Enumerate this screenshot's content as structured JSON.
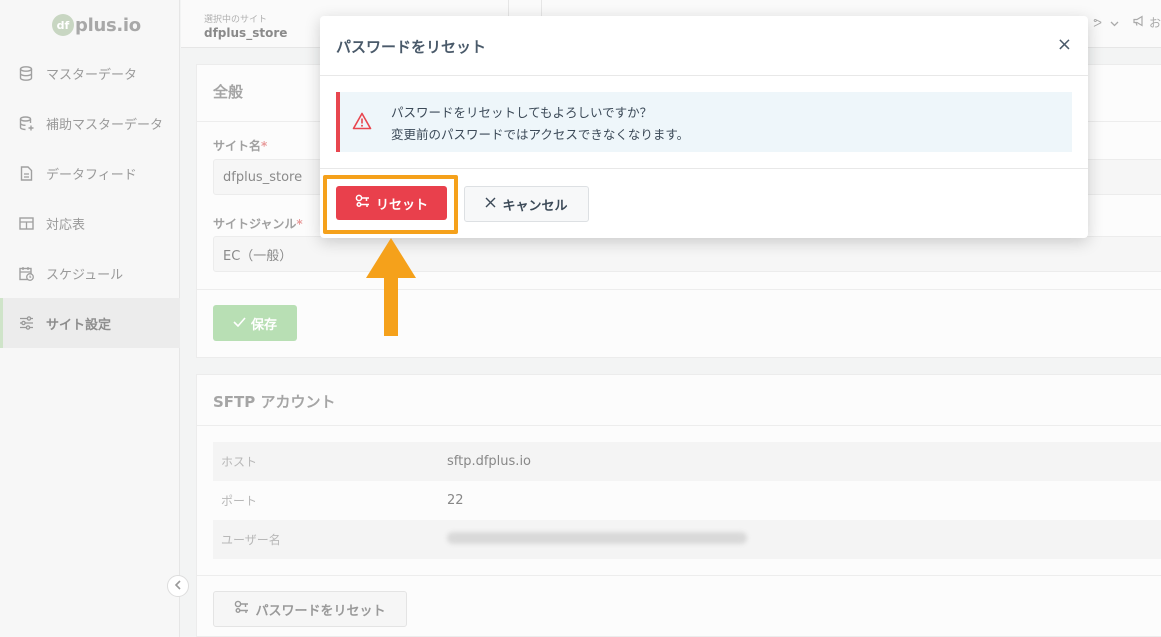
{
  "app": {
    "logo_mark": "df",
    "logo_text": "plus.io"
  },
  "sidebar": {
    "items": [
      {
        "label": "マスターデータ",
        "icon": "database-icon"
      },
      {
        "label": "補助マスターデータ",
        "icon": "database-plus-icon"
      },
      {
        "label": "データフィード",
        "icon": "document-icon"
      },
      {
        "label": "対応表",
        "icon": "table-icon"
      },
      {
        "label": "スケジュール",
        "icon": "calendar-clock-icon"
      },
      {
        "label": "サイト設定",
        "icon": "sliders-icon",
        "active": true
      }
    ]
  },
  "header": {
    "site_label": "選択中のサイト",
    "site_value": "dfplus_store",
    "right_text_1": "ᕗ",
    "right_text_2": "お"
  },
  "general": {
    "title": "全般",
    "site_name_label": "サイト名",
    "site_name_value": "dfplus_store",
    "site_genre_label": "サイトジャンル",
    "site_genre_value": "EC（一般）",
    "save_label": "保存",
    "required_mark": "*"
  },
  "sftp": {
    "title": "SFTP アカウント",
    "rows": [
      {
        "key": "ホスト",
        "value": "sftp.dfplus.io"
      },
      {
        "key": "ポート",
        "value": "22"
      },
      {
        "key": "ユーザー名",
        "value": ""
      }
    ],
    "reset_button_label": "パスワードをリセット"
  },
  "modal": {
    "title": "パスワードをリセット",
    "alert_line1": "パスワードをリセットしてもよろしいですか？",
    "alert_line2": "変更前のパスワードではアクセスできなくなります。",
    "confirm_label": "リセット",
    "cancel_label": "キャンセル",
    "close_glyph": "×"
  },
  "colors": {
    "danger": "#e9404c",
    "highlight": "#f5a11b",
    "save_green": "#b8dfb4"
  }
}
